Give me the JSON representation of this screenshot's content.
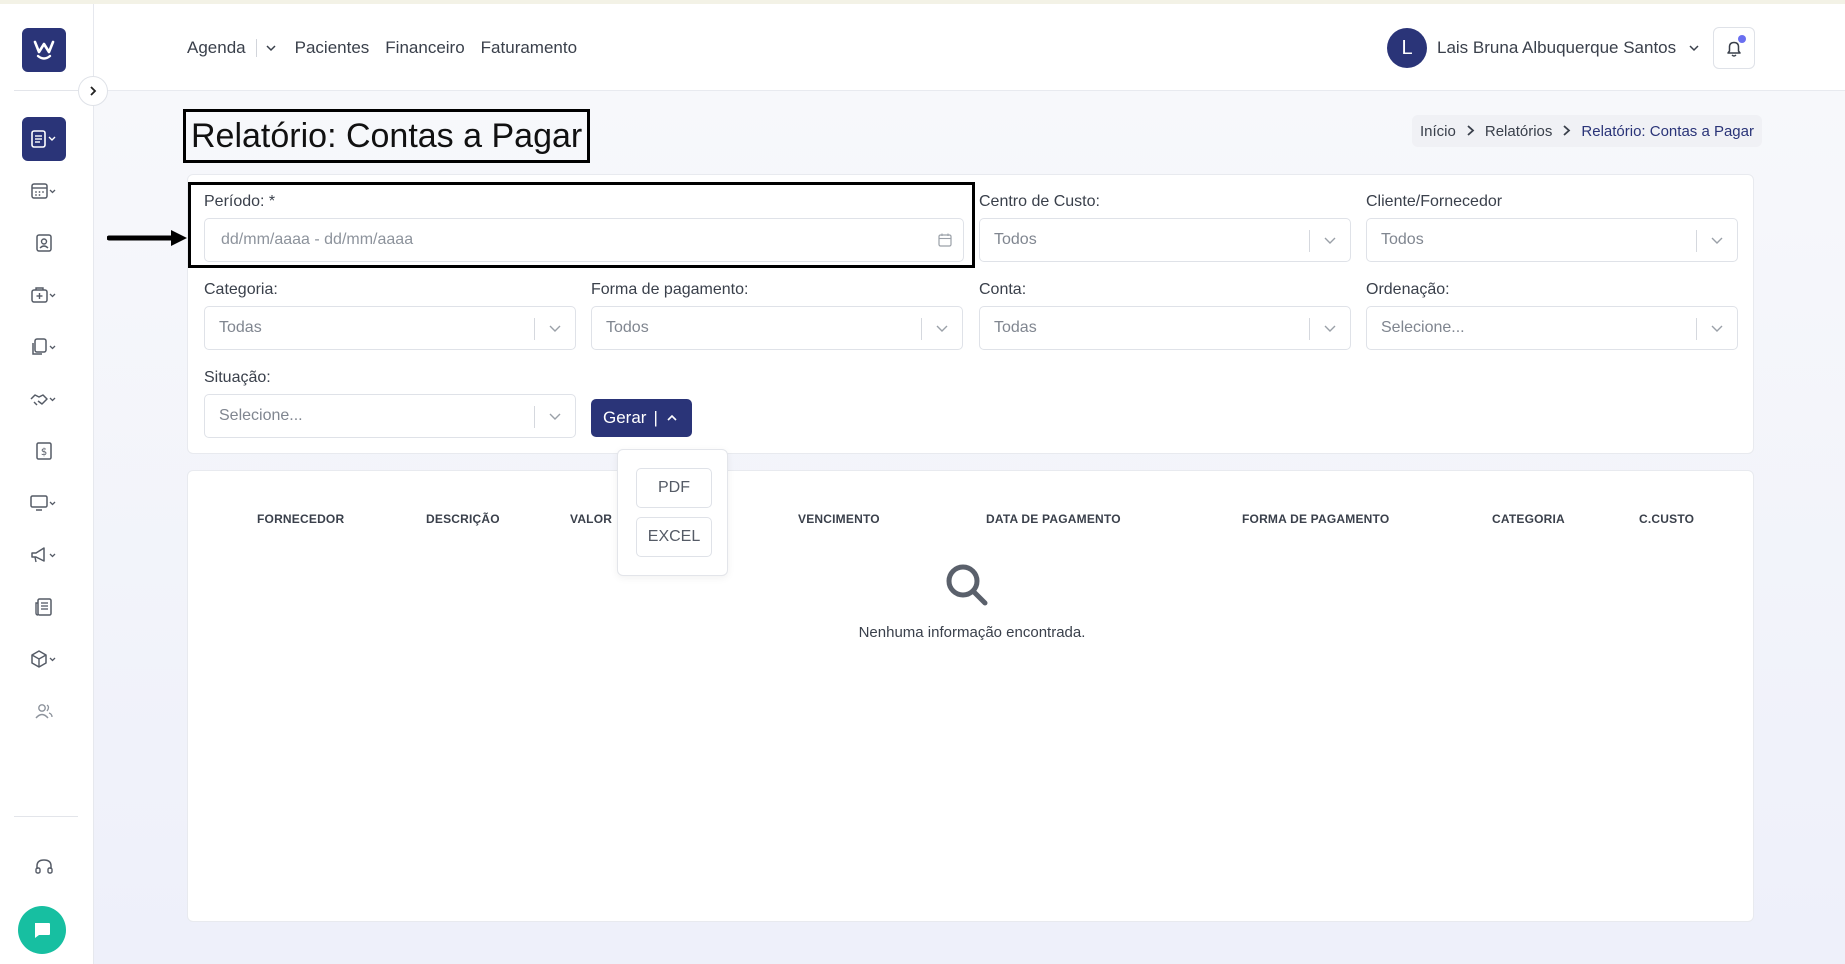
{
  "header": {
    "nav": [
      "Agenda",
      "Pacientes",
      "Financeiro",
      "Faturamento"
    ],
    "user": {
      "initial": "L",
      "name": "Lais Bruna Albuquerque Santos"
    }
  },
  "page": {
    "title": "Relatório: Contas a Pagar",
    "breadcrumb": [
      "Início",
      "Relatórios",
      "Relatório: Contas a Pagar"
    ]
  },
  "filters": {
    "periodo": {
      "label": "Período: *",
      "placeholder": "dd/mm/aaaa - dd/mm/aaaa"
    },
    "centro_custo": {
      "label": "Centro de Custo:",
      "value": "Todos"
    },
    "cliente_fornecedor": {
      "label": "Cliente/Fornecedor",
      "value": "Todos"
    },
    "categoria": {
      "label": "Categoria:",
      "value": "Todas"
    },
    "forma_pagamento": {
      "label": "Forma de pagamento:",
      "value": "Todos"
    },
    "conta": {
      "label": "Conta:",
      "value": "Todas"
    },
    "ordenacao": {
      "label": "Ordenação:",
      "value": "Selecione..."
    },
    "situacao": {
      "label": "Situação:",
      "value": "Selecione..."
    }
  },
  "actions": {
    "gerar_label": "Gerar",
    "pipe": "|",
    "export_options": [
      "PDF",
      "EXCEL"
    ]
  },
  "table": {
    "columns": [
      "FORNECEDOR",
      "DESCRIÇÃO",
      "VALOR",
      "VENCIMENTO",
      "DATA DE PAGAMENTO",
      "FORMA DE PAGAMENTO",
      "CATEGORIA",
      "C.CUSTO"
    ],
    "empty_message": "Nenhuma informação encontrada."
  },
  "colors": {
    "primary": "#2a3478",
    "chat": "#17bfa1",
    "notification_dot": "#6a6ff0"
  },
  "icons": {
    "sidebar": [
      "reports-icon",
      "calendar-icon",
      "patient-badge-icon",
      "medical-bag-icon",
      "documents-icon",
      "handshake-icon",
      "invoice-dollar-icon",
      "monitor-icon",
      "megaphone-icon",
      "newspaper-icon",
      "box-icon",
      "users-icon"
    ],
    "support": "headset-icon",
    "chat": "chat-bubble-icon",
    "notifications": "bell-icon"
  }
}
